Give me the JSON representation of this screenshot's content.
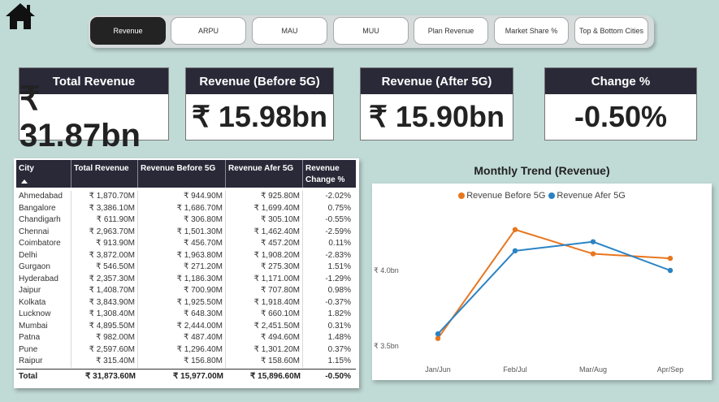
{
  "tabs": [
    "Revenue",
    "ARPU",
    "MAU",
    "MUU",
    "Plan Revenue",
    "Market Share %",
    "Top & Bottom Cities"
  ],
  "active_tab": "Revenue",
  "cards": [
    {
      "title": "Total Revenue",
      "value": "₹ 31.87bn"
    },
    {
      "title": "Revenue (Before 5G)",
      "value": "₹ 15.98bn"
    },
    {
      "title": "Revenue (After 5G)",
      "value": "₹ 15.90bn"
    },
    {
      "title": "Change %",
      "value": "-0.50%"
    }
  ],
  "table": {
    "headers": [
      "City",
      "Total Revenue",
      "Revenue Before 5G",
      "Revenue Afer 5G",
      "Revenue Change %"
    ],
    "rows": [
      [
        "Ahmedabad",
        "₹ 1,870.70M",
        "₹ 944.90M",
        "₹ 925.80M",
        "-2.02%"
      ],
      [
        "Bangalore",
        "₹ 3,386.10M",
        "₹ 1,686.70M",
        "₹ 1,699.40M",
        "0.75%"
      ],
      [
        "Chandigarh",
        "₹ 611.90M",
        "₹ 306.80M",
        "₹ 305.10M",
        "-0.55%"
      ],
      [
        "Chennai",
        "₹ 2,963.70M",
        "₹ 1,501.30M",
        "₹ 1,462.40M",
        "-2.59%"
      ],
      [
        "Coimbatore",
        "₹ 913.90M",
        "₹ 456.70M",
        "₹ 457.20M",
        "0.11%"
      ],
      [
        "Delhi",
        "₹ 3,872.00M",
        "₹ 1,963.80M",
        "₹ 1,908.20M",
        "-2.83%"
      ],
      [
        "Gurgaon",
        "₹ 546.50M",
        "₹ 271.20M",
        "₹ 275.30M",
        "1.51%"
      ],
      [
        "Hyderabad",
        "₹ 2,357.30M",
        "₹ 1,186.30M",
        "₹ 1,171.00M",
        "-1.29%"
      ],
      [
        "Jaipur",
        "₹ 1,408.70M",
        "₹ 700.90M",
        "₹ 707.80M",
        "0.98%"
      ],
      [
        "Kolkata",
        "₹ 3,843.90M",
        "₹ 1,925.50M",
        "₹ 1,918.40M",
        "-0.37%"
      ],
      [
        "Lucknow",
        "₹ 1,308.40M",
        "₹ 648.30M",
        "₹ 660.10M",
        "1.82%"
      ],
      [
        "Mumbai",
        "₹ 4,895.50M",
        "₹ 2,444.00M",
        "₹ 2,451.50M",
        "0.31%"
      ],
      [
        "Patna",
        "₹ 982.00M",
        "₹ 487.40M",
        "₹ 494.60M",
        "1.48%"
      ],
      [
        "Pune",
        "₹ 2,597.60M",
        "₹ 1,296.40M",
        "₹ 1,301.20M",
        "0.37%"
      ],
      [
        "Raipur",
        "₹ 315.40M",
        "₹ 156.80M",
        "₹ 158.60M",
        "1.15%"
      ]
    ],
    "total": [
      "Total",
      "₹ 31,873.60M",
      "₹ 15,977.00M",
      "₹ 15,896.60M",
      "-0.50%"
    ]
  },
  "chart_title": "Monthly Trend (Revenue)",
  "chart_data": {
    "type": "line",
    "categories": [
      "Jan/Jun",
      "Feb/Jul",
      "Mar/Aug",
      "Apr/Sep"
    ],
    "series": [
      {
        "name": "Revenue Before 5G",
        "color": "#e8761f",
        "values": [
          3.55,
          4.27,
          4.11,
          4.08
        ]
      },
      {
        "name": "Revenue Afer 5G",
        "color": "#2a83c4",
        "values": [
          3.58,
          4.13,
          4.19,
          4.0
        ]
      }
    ],
    "y_ticks": [
      {
        "value": 3.5,
        "label": "₹ 3.5bn"
      },
      {
        "value": 4.0,
        "label": "₹ 4.0bn"
      }
    ],
    "ylim": [
      3.5,
      4.0
    ],
    "grid": false,
    "legend_position": "top"
  },
  "icons": {
    "home": "home-icon",
    "sort": "sort-ascending-icon"
  }
}
